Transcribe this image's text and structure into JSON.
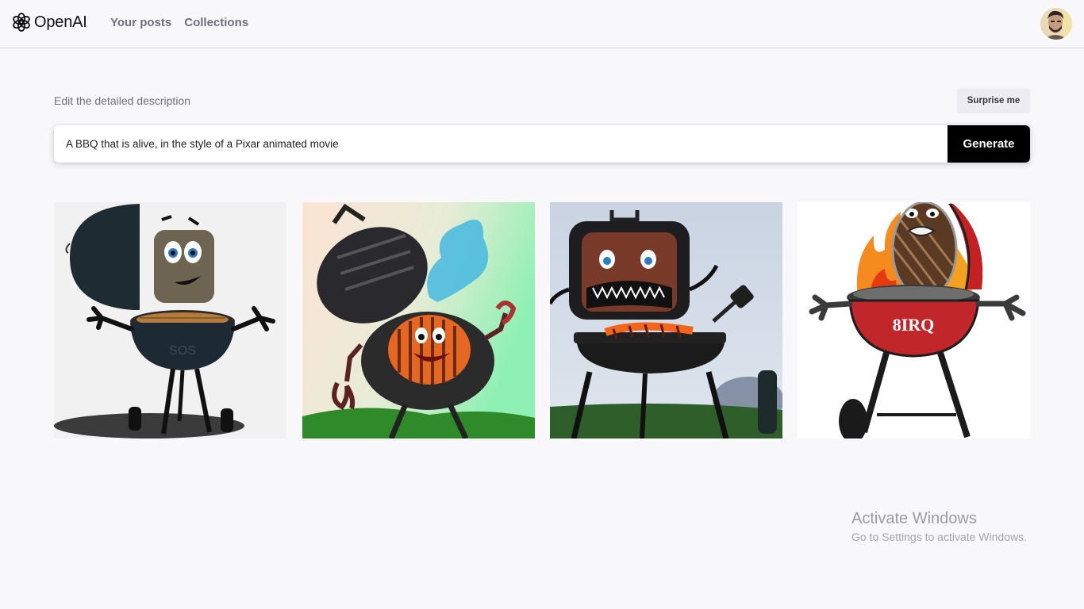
{
  "header": {
    "brand": "OpenAI",
    "nav": [
      {
        "label": "Your posts"
      },
      {
        "label": "Collections"
      }
    ]
  },
  "prompt": {
    "label": "Edit the detailed description",
    "surprise_label": "Surprise me",
    "value": "A BBQ that is alive, in the style of a Pixar animated movie",
    "generate_label": "Generate"
  },
  "results": [
    {
      "name": "grill-image-1",
      "grill_text": "SOS"
    },
    {
      "name": "grill-image-2"
    },
    {
      "name": "grill-image-3"
    },
    {
      "name": "grill-image-4",
      "grill_text": "8IRQ"
    }
  ],
  "watermark": {
    "title": "Activate Windows",
    "subtitle": "Go to Settings to activate Windows."
  },
  "colors": {
    "background": "#f8f8fb",
    "button_dark": "#000000",
    "nav_text": "#6e6e80"
  }
}
